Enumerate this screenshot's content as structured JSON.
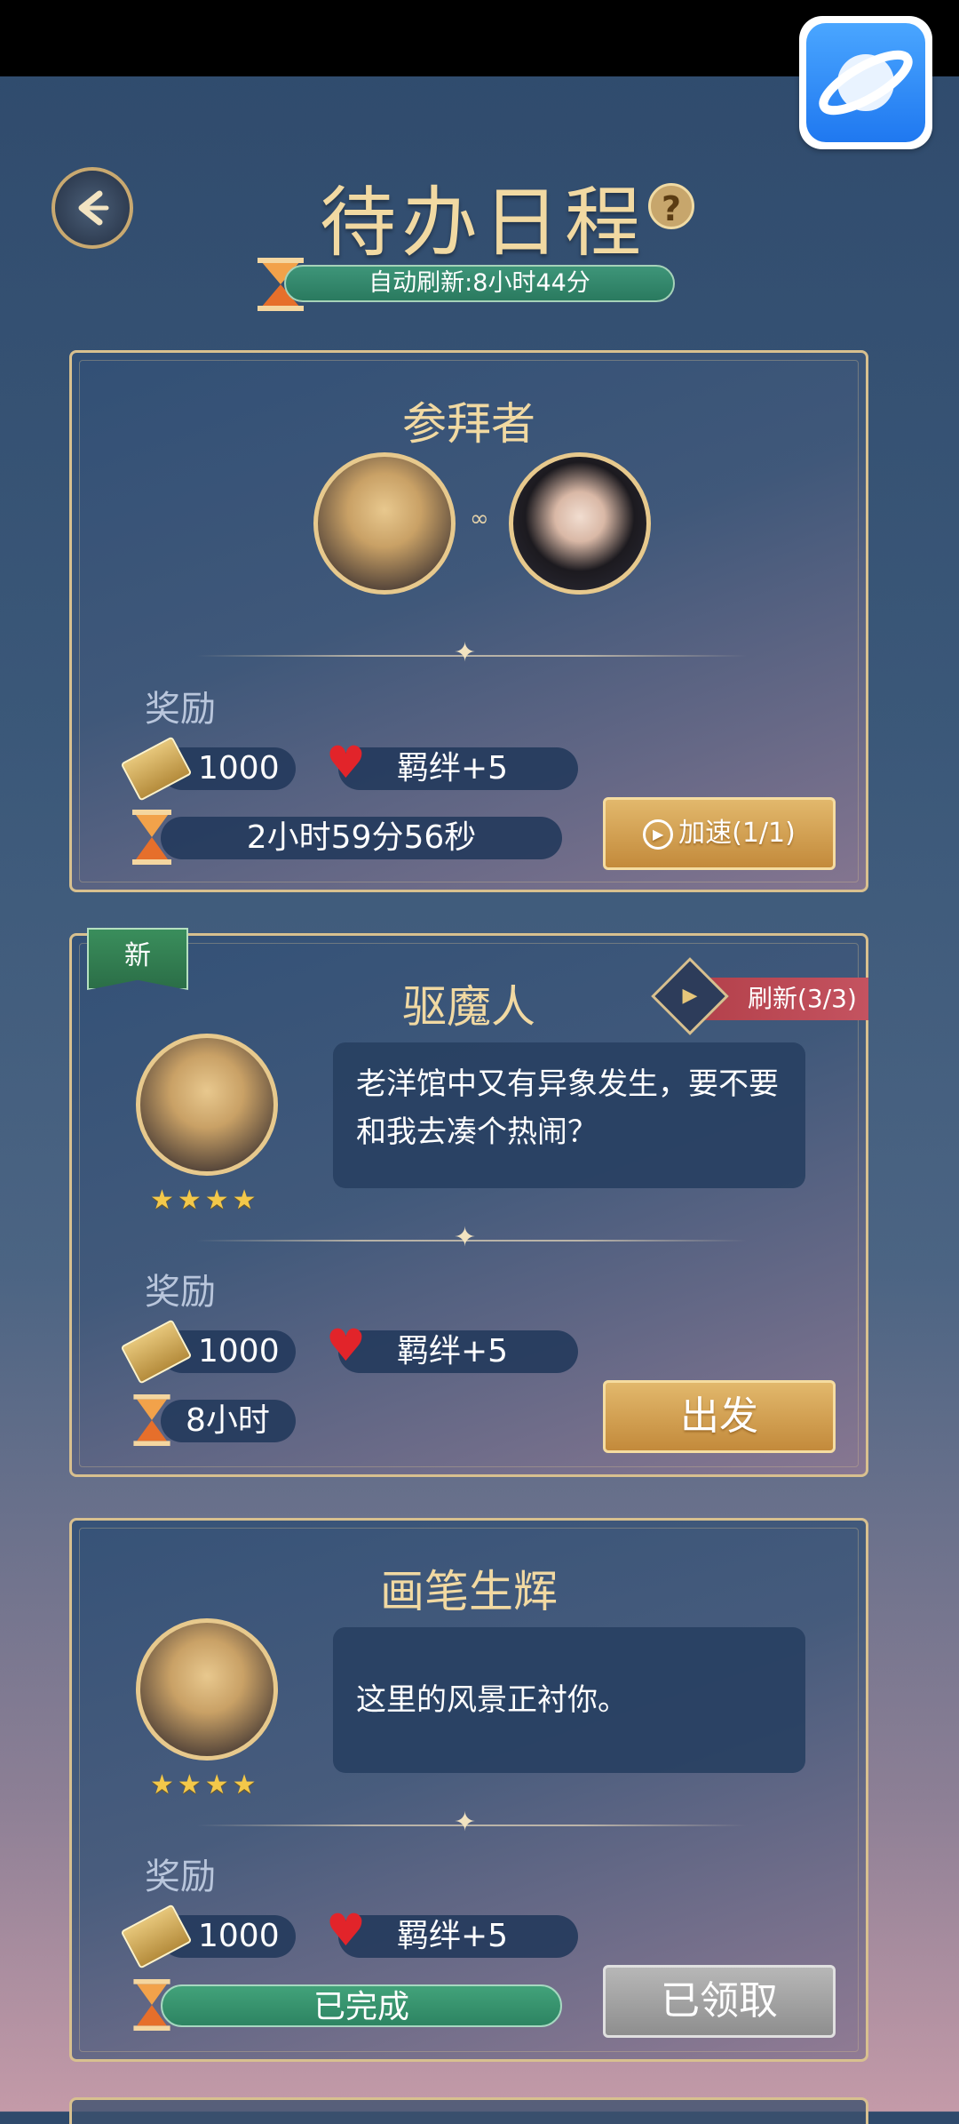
{
  "header": {
    "title": "待办日程",
    "help_label": "?",
    "auto_refresh": "自动刷新:8小时44分"
  },
  "colors": {
    "title_gold": "#f1d9a2",
    "card_border": "#d8c08f",
    "pill_bg": "#233a5c",
    "green_bar": "#2d8462",
    "red_tag": "#c45360",
    "heart": "#e2242a"
  },
  "reward_label": "奖励",
  "cards": [
    {
      "title": "参拜者",
      "characters": [
        "blonde-male-portrait",
        "black-hair-female-portrait"
      ],
      "coin": "1000",
      "bond": "羁绊+5",
      "timer": "2小时59分56秒",
      "action": "加速(1/1)"
    },
    {
      "badge": "新",
      "title": "驱魔人",
      "refresh": "刷新(3/3)",
      "dialogue": "老洋馆中又有异象发生，要不要和我去凑个热闹？",
      "stars": "★★★★",
      "coin": "1000",
      "bond": "羁绊+5",
      "duration": "8小时",
      "action": "出发"
    },
    {
      "title": "画笔生辉",
      "dialogue": "这里的风景正衬你。",
      "stars": "★★★★",
      "coin": "1000",
      "bond": "羁绊+5",
      "status": "已完成",
      "action": "已领取"
    }
  ]
}
